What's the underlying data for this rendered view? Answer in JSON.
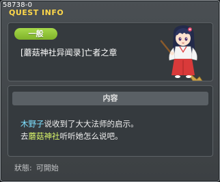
{
  "quest_id": "58738-0",
  "window_title": "QUEST INFO",
  "category_label": "一般",
  "quest_name": "[蘑菇神社异闻录]亡者之章",
  "content": {
    "header": "内容",
    "line1": {
      "npc": "木野子",
      "text": "说收到了大大法师的启示。"
    },
    "line2": {
      "prefix": "去",
      "map": "蘑菇神社",
      "suffix": "听听她怎么说吧。"
    }
  },
  "status": {
    "label": "狀態:",
    "value": "可開始"
  },
  "npc_image": "shrine-maiden-with-broom",
  "colors": {
    "title": "#ffd84a",
    "pill": "#8cc63f",
    "npc_highlight": "#7ee0ff",
    "map_highlight": "#d9f56a"
  }
}
